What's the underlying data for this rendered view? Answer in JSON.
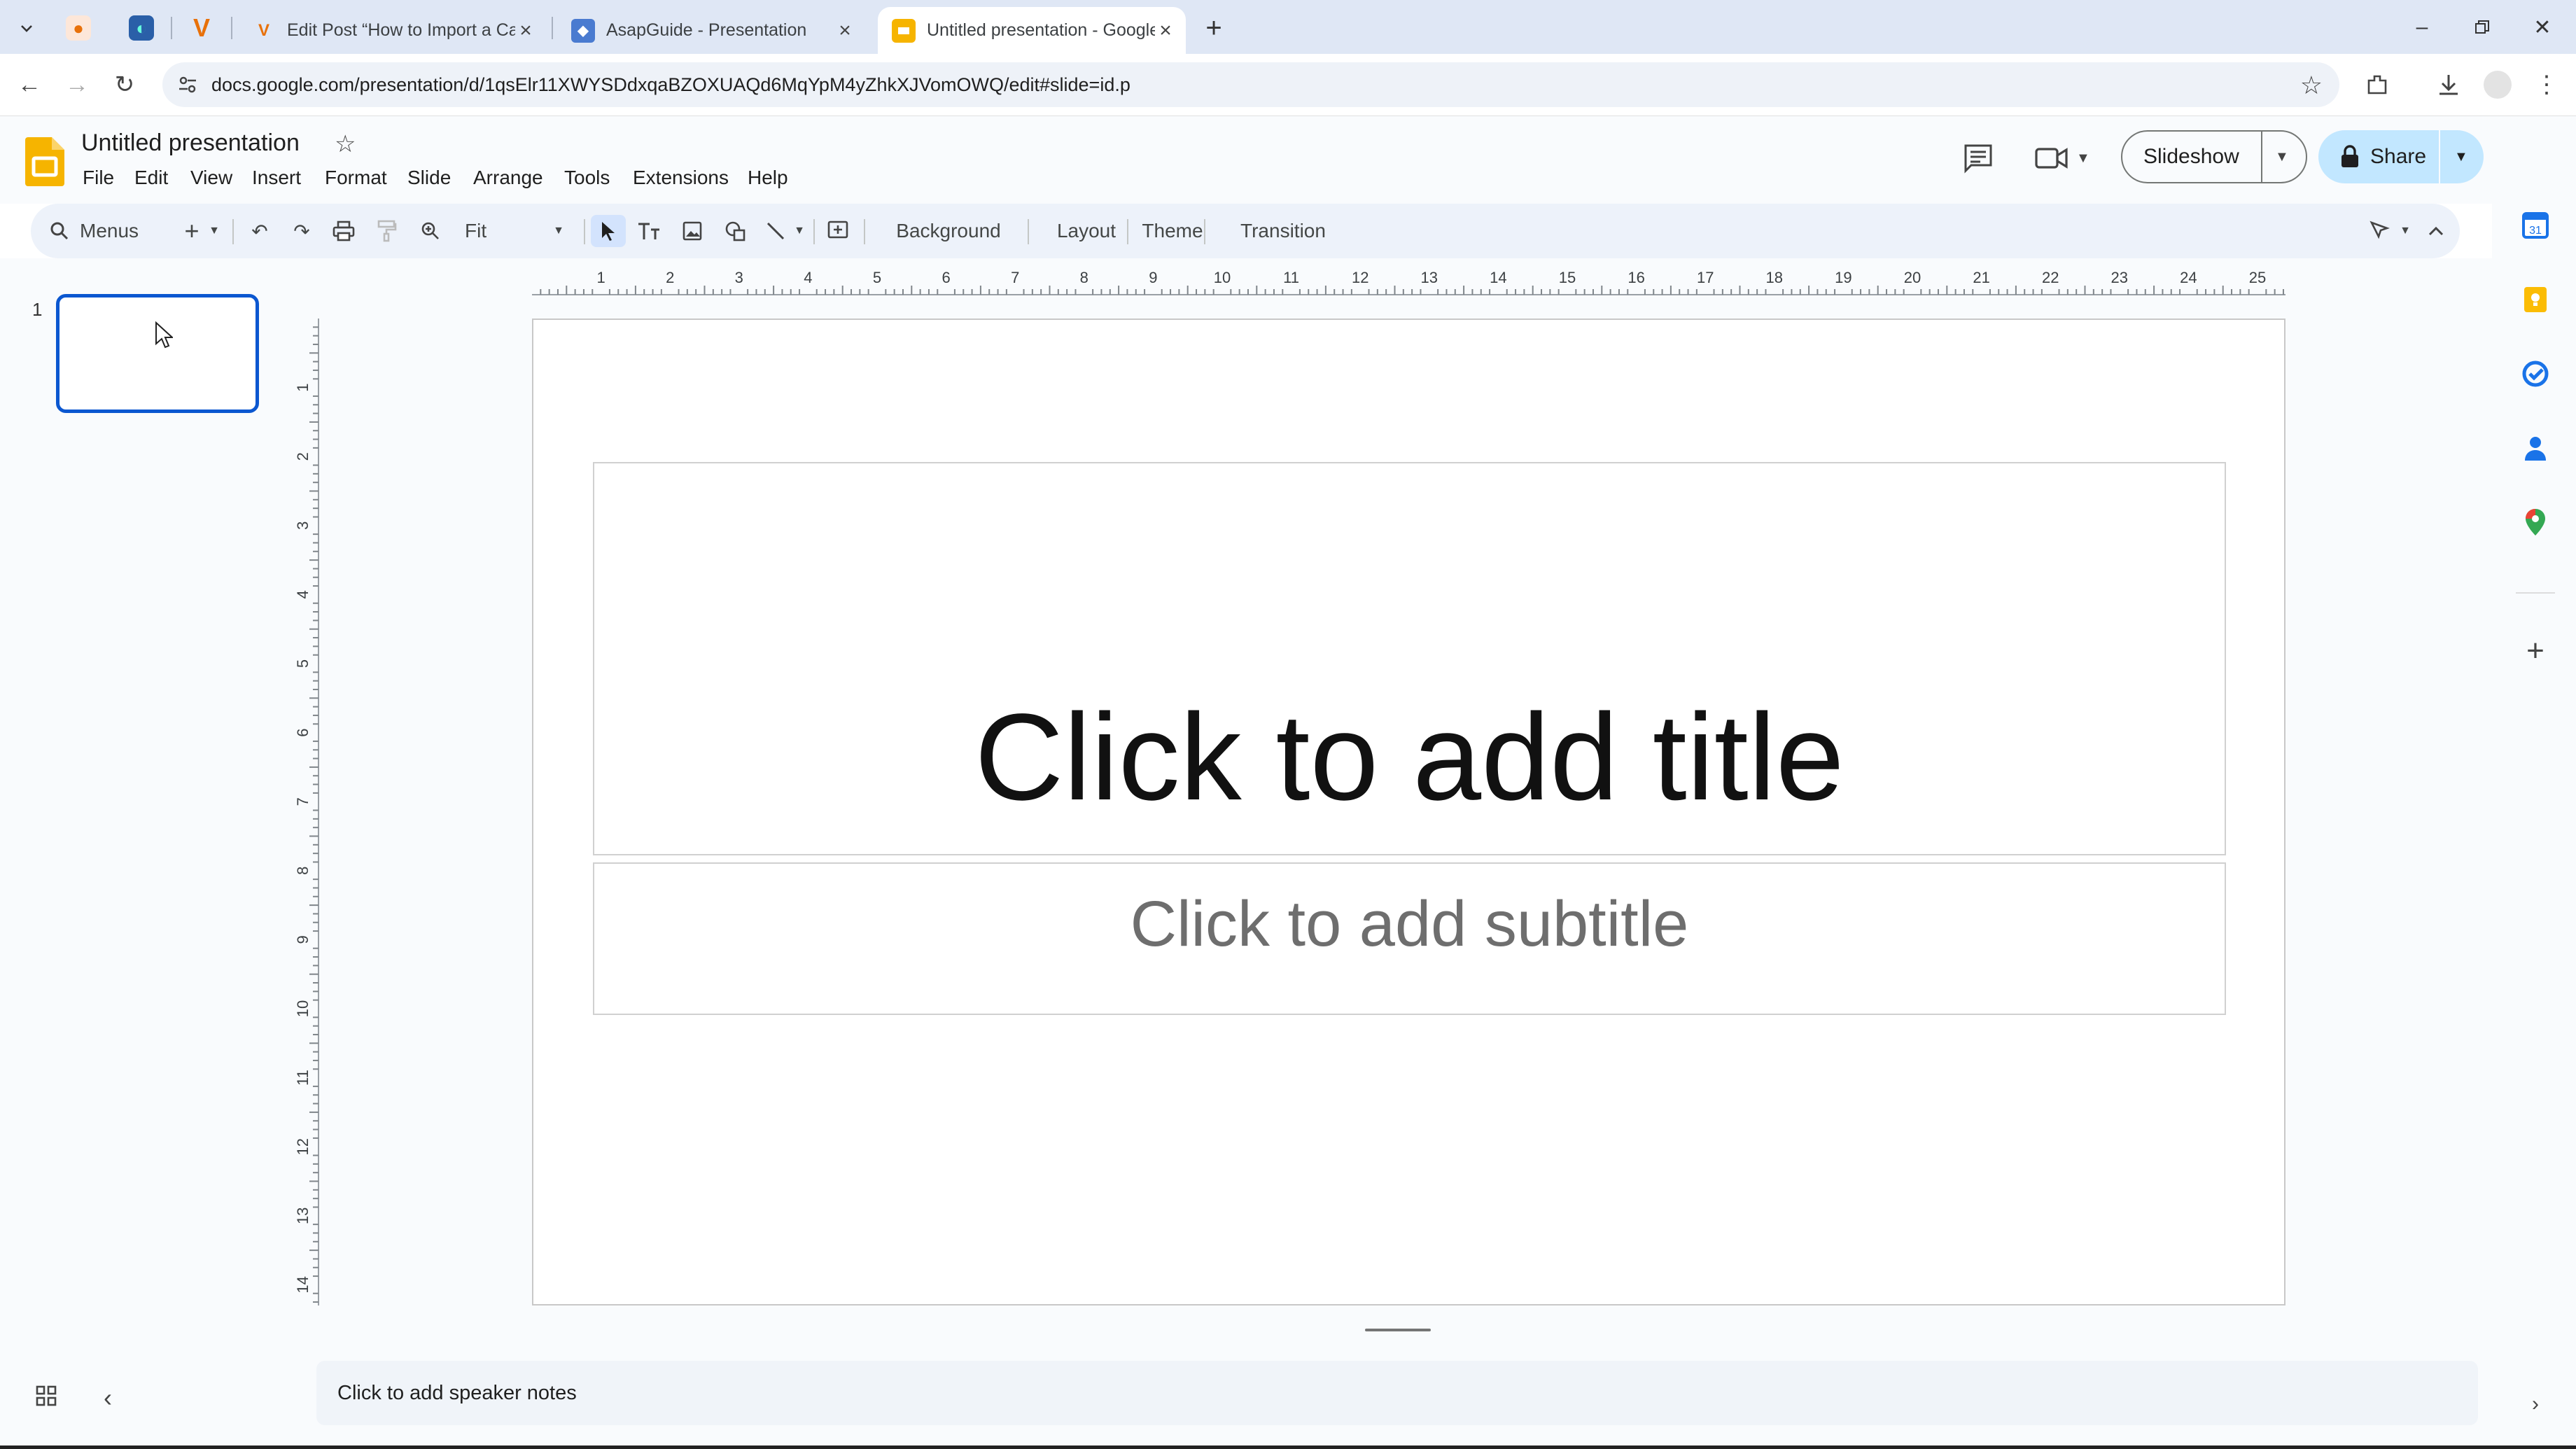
{
  "browser": {
    "tabs": [
      {
        "title": "Edit Post “How to Import a Car",
        "favicon": "V",
        "favicon_color": "#e8710a"
      },
      {
        "title": "AsapGuide - Presentation",
        "favicon": "asapguide-icon",
        "favicon_color": "#4a7bd0"
      },
      {
        "title": "Untitled presentation - Google",
        "favicon": "slides-icon",
        "favicon_color": "#f6b400",
        "active": true
      }
    ],
    "url": "docs.google.com/presentation/d/1qsElr11XWYSDdxqaBZOXUAQd6MqYpM4yZhkXJVomOWQ/edit#slide=id.p"
  },
  "app": {
    "doc_title": "Untitled presentation",
    "menus": [
      "File",
      "Edit",
      "View",
      "Insert",
      "Format",
      "Slide",
      "Arrange",
      "Tools",
      "Extensions",
      "Help"
    ],
    "slideshow_label": "Slideshow",
    "share_label": "Share",
    "accent": "#0b57d0",
    "share_bg": "#c2e7ff"
  },
  "toolbar": {
    "menus_search": "Menus",
    "zoom": "Fit",
    "background": "Background",
    "layout": "Layout",
    "theme": "Theme",
    "transition": "Transition"
  },
  "filmstrip": {
    "slide_number": "1"
  },
  "rulers": {
    "horizontal": [
      "1",
      "2",
      "3",
      "4",
      "5",
      "6",
      "7",
      "8",
      "9",
      "10",
      "11",
      "12",
      "13",
      "14",
      "15",
      "16",
      "17",
      "18",
      "19",
      "20",
      "21",
      "22",
      "23",
      "24",
      "25"
    ],
    "vertical": [
      "1",
      "2",
      "3",
      "4",
      "5",
      "6",
      "7",
      "8",
      "9",
      "10",
      "11",
      "12",
      "13",
      "14"
    ]
  },
  "slide": {
    "title_placeholder": "Click to add title",
    "subtitle_placeholder": "Click to add subtitle"
  },
  "notes": {
    "placeholder": "Click to add speaker notes"
  }
}
